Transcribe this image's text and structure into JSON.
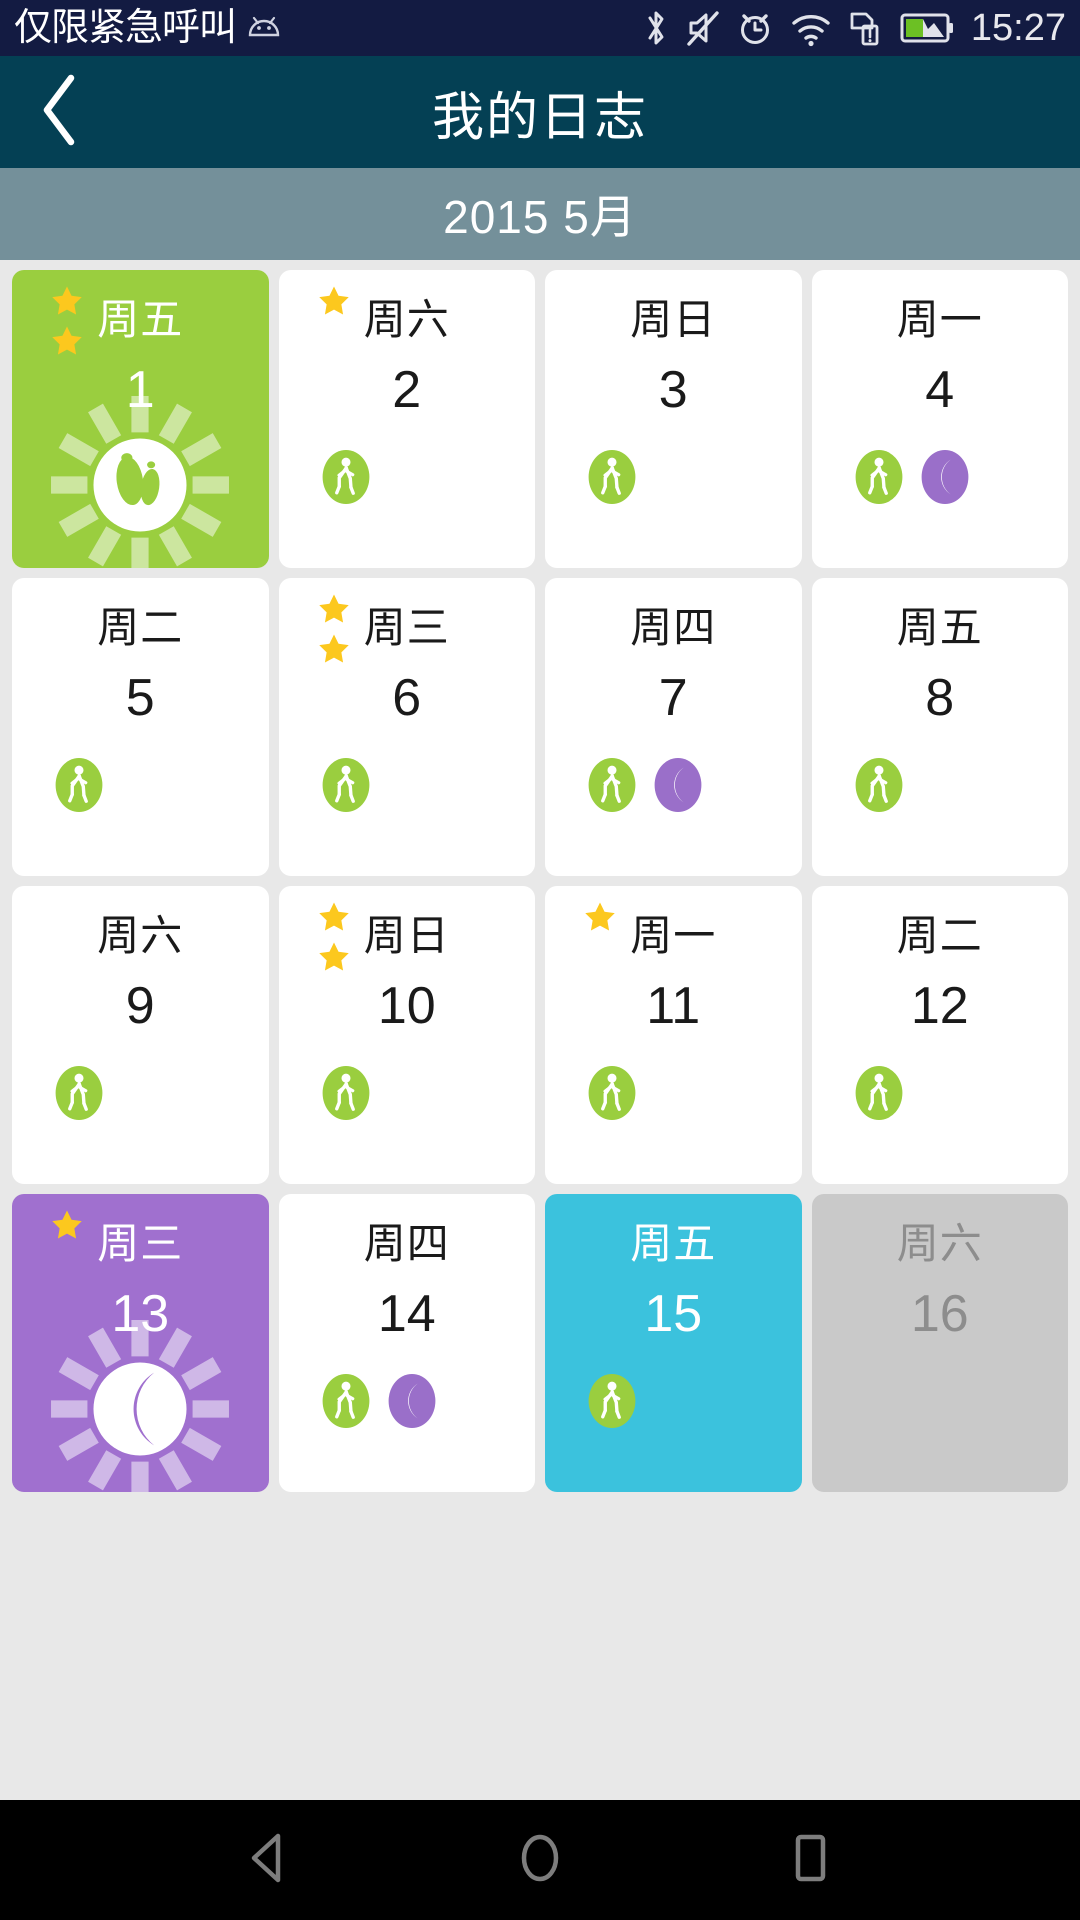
{
  "statusbar": {
    "carrier_text": "仅限紧急呼叫",
    "clock": "15:27",
    "icons": [
      "android-icon",
      "bluetooth-icon",
      "mute-icon",
      "alarm-icon",
      "wifi-icon",
      "sim-card-icon",
      "battery-charging-icon"
    ]
  },
  "titlebar": {
    "back_icon": "chevron-left-icon",
    "title": "我的日志"
  },
  "monthbar": {
    "label": "2015  5月"
  },
  "calendar": {
    "days": [
      {
        "weekday": "周五",
        "num": "1",
        "stars": 2,
        "theme": "green",
        "badges": [],
        "hero": "footprint-sunburst"
      },
      {
        "weekday": "周六",
        "num": "2",
        "stars": 1,
        "theme": "white",
        "badges": [
          "walk"
        ],
        "hero": null
      },
      {
        "weekday": "周日",
        "num": "3",
        "stars": 0,
        "theme": "white",
        "badges": [
          "walk"
        ],
        "hero": null
      },
      {
        "weekday": "周一",
        "num": "4",
        "stars": 0,
        "theme": "white",
        "badges": [
          "walk",
          "moon"
        ],
        "hero": null
      },
      {
        "weekday": "周二",
        "num": "5",
        "stars": 0,
        "theme": "white",
        "badges": [
          "walk"
        ],
        "hero": null
      },
      {
        "weekday": "周三",
        "num": "6",
        "stars": 2,
        "theme": "white",
        "badges": [
          "walk"
        ],
        "hero": null
      },
      {
        "weekday": "周四",
        "num": "7",
        "stars": 0,
        "theme": "white",
        "badges": [
          "walk",
          "moon"
        ],
        "hero": null
      },
      {
        "weekday": "周五",
        "num": "8",
        "stars": 0,
        "theme": "white",
        "badges": [
          "walk"
        ],
        "hero": null
      },
      {
        "weekday": "周六",
        "num": "9",
        "stars": 0,
        "theme": "white",
        "badges": [
          "walk"
        ],
        "hero": null
      },
      {
        "weekday": "周日",
        "num": "10",
        "stars": 2,
        "theme": "white",
        "badges": [
          "walk"
        ],
        "hero": null
      },
      {
        "weekday": "周一",
        "num": "11",
        "stars": 1,
        "theme": "white",
        "badges": [
          "walk"
        ],
        "hero": null
      },
      {
        "weekday": "周二",
        "num": "12",
        "stars": 0,
        "theme": "white",
        "badges": [
          "walk"
        ],
        "hero": null
      },
      {
        "weekday": "周三",
        "num": "13",
        "stars": 1,
        "theme": "purple",
        "badges": [],
        "hero": "moon-sunburst"
      },
      {
        "weekday": "周四",
        "num": "14",
        "stars": 0,
        "theme": "white",
        "badges": [
          "walk",
          "moon"
        ],
        "hero": null
      },
      {
        "weekday": "周五",
        "num": "15",
        "stars": 0,
        "theme": "cyan",
        "badges": [
          "walk"
        ],
        "hero": null
      },
      {
        "weekday": "周六",
        "num": "16",
        "stars": 0,
        "theme": "gray",
        "badges": [],
        "hero": null
      }
    ]
  },
  "navbar": {
    "buttons": [
      "back-triangle-icon",
      "home-circle-icon",
      "recents-square-icon"
    ]
  },
  "colors": {
    "statusbar_bg": "#131b42",
    "titlebar_bg": "#044054",
    "monthbar_bg": "#74909a",
    "page_bg": "#e8e8e8",
    "card_green": "#9ace3f",
    "card_purple": "#a070cf",
    "card_cyan": "#3bc2dd",
    "card_gray": "#c9c9c9",
    "badge_walk": "#9ace3f",
    "badge_moon": "#9a6fc9",
    "star": "#fcc81e"
  }
}
